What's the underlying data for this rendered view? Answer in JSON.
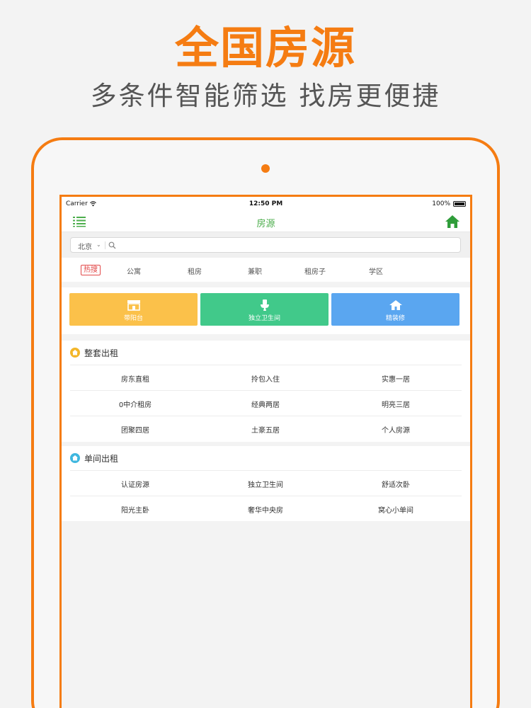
{
  "promo": {
    "title": "全国房源",
    "subtitle": "多条件智能筛选 找房更便捷"
  },
  "status_bar": {
    "carrier": "Carrier",
    "time": "12:50 PM",
    "battery": "100%"
  },
  "nav": {
    "title": "房源",
    "title_color": "#4cae4c"
  },
  "search": {
    "city": "北京",
    "placeholder": ""
  },
  "hot": {
    "tag": "热搜",
    "items": [
      "公寓",
      "租房",
      "兼职",
      "租房子",
      "学区"
    ]
  },
  "features": [
    {
      "label": "带阳台",
      "icon": "shop-icon",
      "color": "#fbc14a"
    },
    {
      "label": "独立卫生间",
      "icon": "toilet-icon",
      "color": "#41c98a"
    },
    {
      "label": "精装修",
      "icon": "house-icon",
      "color": "#5aa6f0"
    }
  ],
  "sections": [
    {
      "title": "整套出租",
      "icon_color": "#f3b629",
      "rows": [
        [
          "房东直租",
          "拎包入住",
          "实惠一居"
        ],
        [
          "0中介租房",
          "经典两居",
          "明亮三居"
        ],
        [
          "团聚四居",
          "土豪五居",
          "个人房源"
        ]
      ]
    },
    {
      "title": "单间出租",
      "icon_color": "#3fb7df",
      "rows": [
        [
          "认证房源",
          "独立卫生间",
          "舒适次卧"
        ],
        [
          "阳光主卧",
          "奢华中央房",
          "窝心小单间"
        ]
      ]
    }
  ],
  "colors": {
    "accent": "#f57c12",
    "hot_red": "#e24848"
  }
}
